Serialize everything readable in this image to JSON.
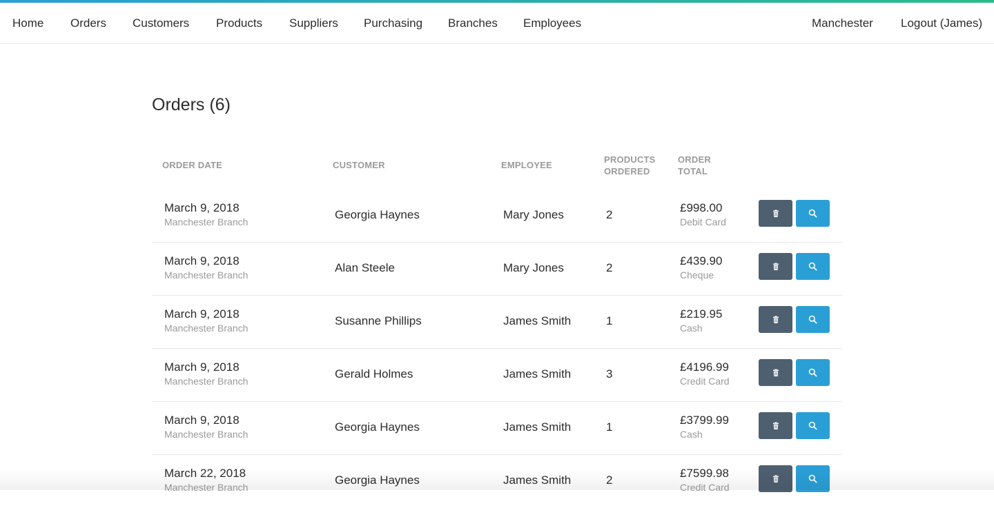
{
  "nav": {
    "left": [
      "Home",
      "Orders",
      "Customers",
      "Products",
      "Suppliers",
      "Purchasing",
      "Branches",
      "Employees"
    ],
    "branch": "Manchester",
    "logout": "Logout (James)"
  },
  "page": {
    "title": "Orders (6)"
  },
  "table": {
    "headers": {
      "order_date": "ORDER DATE",
      "customer": "CUSTOMER",
      "employee": "EMPLOYEE",
      "products_line1": "PRODUCTS",
      "products_line2": "ORDERED",
      "total_line1": "ORDER",
      "total_line2": "TOTAL"
    },
    "rows": [
      {
        "date": "March 9, 2018",
        "branch": "Manchester Branch",
        "customer": "Georgia Haynes",
        "employee": "Mary Jones",
        "products": "2",
        "total": "£998.00",
        "payment": "Debit Card"
      },
      {
        "date": "March 9, 2018",
        "branch": "Manchester Branch",
        "customer": "Alan Steele",
        "employee": "Mary Jones",
        "products": "2",
        "total": "£439.90",
        "payment": "Cheque"
      },
      {
        "date": "March 9, 2018",
        "branch": "Manchester Branch",
        "customer": "Susanne Phillips",
        "employee": "James Smith",
        "products": "1",
        "total": "£219.95",
        "payment": "Cash"
      },
      {
        "date": "March 9, 2018",
        "branch": "Manchester Branch",
        "customer": "Gerald Holmes",
        "employee": "James Smith",
        "products": "3",
        "total": "£4196.99",
        "payment": "Credit Card"
      },
      {
        "date": "March 9, 2018",
        "branch": "Manchester Branch",
        "customer": "Georgia Haynes",
        "employee": "James Smith",
        "products": "1",
        "total": "£3799.99",
        "payment": "Cash"
      },
      {
        "date": "March 22, 2018",
        "branch": "Manchester Branch",
        "customer": "Georgia Haynes",
        "employee": "James Smith",
        "products": "2",
        "total": "£7599.98",
        "payment": "Credit Card"
      }
    ]
  },
  "icons": {
    "delete": "trash-icon",
    "view": "search-icon"
  },
  "colors": {
    "accent_blue": "#2a9fd6",
    "accent_green": "#2bbc8a",
    "delete_btn": "#4e5f70"
  }
}
